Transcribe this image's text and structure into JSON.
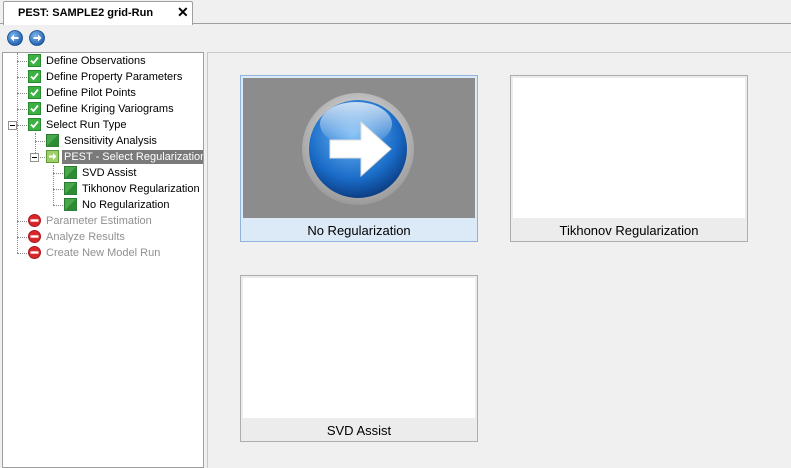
{
  "tab": {
    "title": "PEST: SAMPLE2 grid-Run",
    "close_symbol": "✕"
  },
  "toolbar": {
    "back_icon": "back-arrow-icon",
    "forward_icon": "forward-arrow-icon"
  },
  "tree": {
    "items": [
      {
        "label": "Define Observations",
        "status": "complete"
      },
      {
        "label": "Define Property Parameters",
        "status": "complete"
      },
      {
        "label": "Define Pilot Points",
        "status": "complete"
      },
      {
        "label": "Define Kriging Variograms",
        "status": "complete"
      },
      {
        "label": "Select Run Type",
        "status": "complete"
      },
      {
        "label": "Sensitivity Analysis",
        "status": "option"
      },
      {
        "label": "PEST - Select Regularization",
        "status": "current"
      },
      {
        "label": "SVD Assist",
        "status": "option"
      },
      {
        "label": "Tikhonov Regularization",
        "status": "option"
      },
      {
        "label": "No Regularization",
        "status": "option"
      },
      {
        "label": "Parameter Estimation",
        "status": "blocked"
      },
      {
        "label": "Analyze Results",
        "status": "blocked"
      },
      {
        "label": "Create New Model Run",
        "status": "blocked"
      }
    ]
  },
  "options": [
    {
      "label": "No Regularization",
      "selected": true
    },
    {
      "label": "Tikhonov Regularization",
      "selected": false
    },
    {
      "label": "SVD Assist",
      "selected": false
    }
  ],
  "colors": {
    "complete": "#3cb043",
    "blocked": "#d9262b",
    "accent": "#1f74c9",
    "selected_bg": "#dce9f7"
  }
}
